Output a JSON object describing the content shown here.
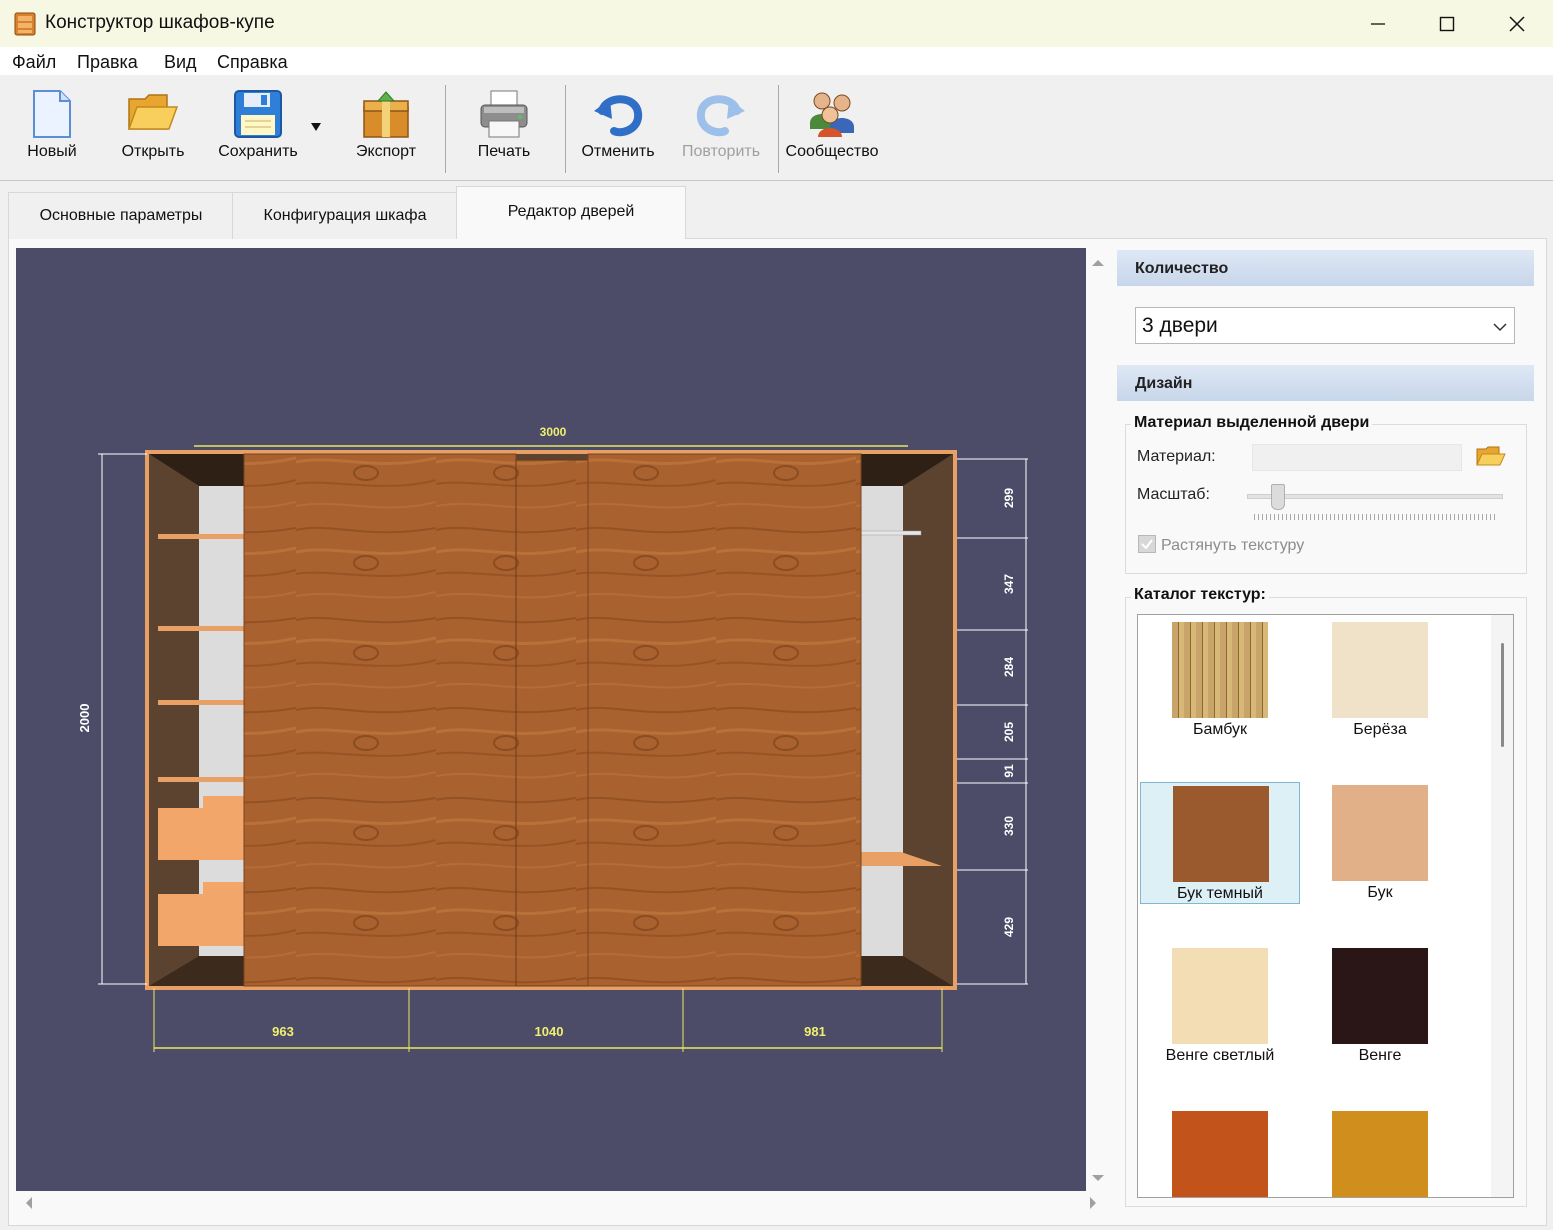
{
  "window": {
    "title": "Конструктор шкафов-купе"
  },
  "menu": [
    "Файл",
    "Правка",
    "Вид",
    "Справка"
  ],
  "toolbar": {
    "new_label": "Новый",
    "open_label": "Открыть",
    "save_label": "Сохранить",
    "export_label": "Экспорт",
    "print_label": "Печать",
    "undo_label": "Отменить",
    "redo_label": "Повторить",
    "community_label": "Сообщество"
  },
  "tabs": [
    "Основные параметры",
    "Конфигурация шкафа",
    "Редактор дверей"
  ],
  "drawing": {
    "total_width": "3000",
    "height": "2000",
    "door_widths": [
      "963",
      "1040",
      "981"
    ],
    "right_sections": [
      "299",
      "347",
      "284",
      "205",
      "91",
      "330",
      "429"
    ]
  },
  "panel": {
    "quantity_header": "Количество",
    "quantity_value": "3 двери",
    "design_header": "Дизайн",
    "material_group": "Материал выделенной двери",
    "material_label": "Материал:",
    "scale_label": "Масштаб:",
    "stretch_label": "Растянуть текстуру",
    "scale_value": 0.1,
    "catalog_title": "Каталог текстур:",
    "textures": [
      {
        "name": "Бамбук",
        "color": "#c9a46a"
      },
      {
        "name": "Берёза",
        "color": "#efe2c8"
      },
      {
        "name": "Бук темный",
        "color": "#9a5a2e"
      },
      {
        "name": "Бук",
        "color": "#e2b088"
      },
      {
        "name": "Венге светлый",
        "color": "#f3ddb5"
      },
      {
        "name": "Венге",
        "color": "#2a1616"
      },
      {
        "name": "",
        "color": "#c2531b"
      },
      {
        "name": "",
        "color": "#d08e1c"
      }
    ]
  }
}
